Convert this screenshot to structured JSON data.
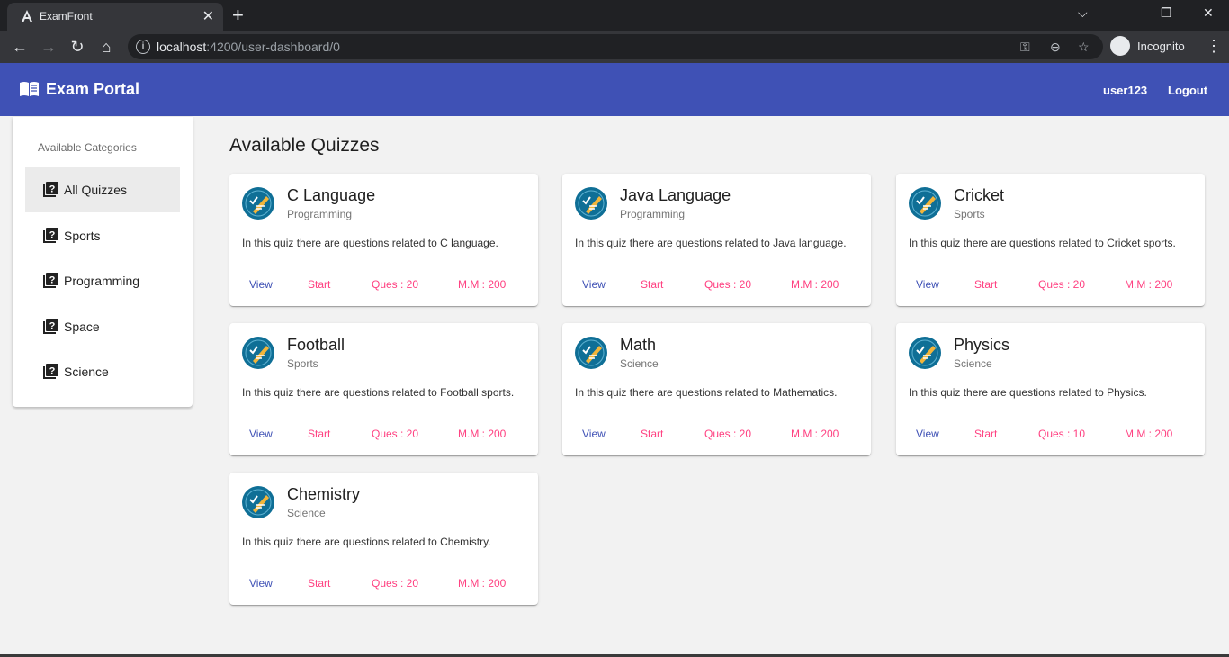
{
  "browser": {
    "tab_title": "ExamFront",
    "tab_close": "✕",
    "new_tab": "+",
    "url_host": "localhost",
    "url_path": ":4200/user-dashboard/0",
    "profile_label": "Incognito",
    "window_controls": [
      "⌵",
      "—",
      "❐",
      "✕"
    ]
  },
  "header": {
    "brand": "Exam Portal",
    "username": "user123",
    "logout": "Logout"
  },
  "sidebar": {
    "heading": "Available Categories",
    "items": [
      {
        "label": "All Quizzes"
      },
      {
        "label": "Sports"
      },
      {
        "label": "Programming"
      },
      {
        "label": "Space"
      },
      {
        "label": "Science"
      }
    ]
  },
  "main": {
    "title": "Available Quizzes",
    "quizzes": [
      {
        "title": "C Language",
        "category": "Programming",
        "description": "In this quiz there are questions related to C language.",
        "view": "View",
        "start": "Start",
        "questions": "Ques : 20",
        "max_marks": "M.M : 200"
      },
      {
        "title": "Java Language",
        "category": "Programming",
        "description": "In this quiz there are questions related to Java language.",
        "view": "View",
        "start": "Start",
        "questions": "Ques : 20",
        "max_marks": "M.M : 200"
      },
      {
        "title": "Cricket",
        "category": "Sports",
        "description": "In this quiz there are questions related to Cricket sports.",
        "view": "View",
        "start": "Start",
        "questions": "Ques : 20",
        "max_marks": "M.M : 200"
      },
      {
        "title": "Football",
        "category": "Sports",
        "description": "In this quiz there are questions related to Football sports.",
        "view": "View",
        "start": "Start",
        "questions": "Ques : 20",
        "max_marks": "M.M : 200"
      },
      {
        "title": "Math",
        "category": "Science",
        "description": "In this quiz there are questions related to Mathematics.",
        "view": "View",
        "start": "Start",
        "questions": "Ques : 20",
        "max_marks": "M.M : 200"
      },
      {
        "title": "Physics",
        "category": "Science",
        "description": "In this quiz there are questions related to Physics.",
        "view": "View",
        "start": "Start",
        "questions": "Ques : 10",
        "max_marks": "M.M : 200"
      },
      {
        "title": "Chemistry",
        "category": "Science",
        "description": "In this quiz there are questions related to Chemistry.",
        "view": "View",
        "start": "Start",
        "questions": "Ques : 20",
        "max_marks": "M.M : 200"
      }
    ]
  },
  "colors": {
    "primary": "#3f51b5",
    "accent": "#ff4081",
    "background": "#f2f2f2"
  },
  "icons": {
    "brand": "menu-book-icon",
    "category": "quiz-icon",
    "quiz_avatar": "quiz-check-icon"
  }
}
